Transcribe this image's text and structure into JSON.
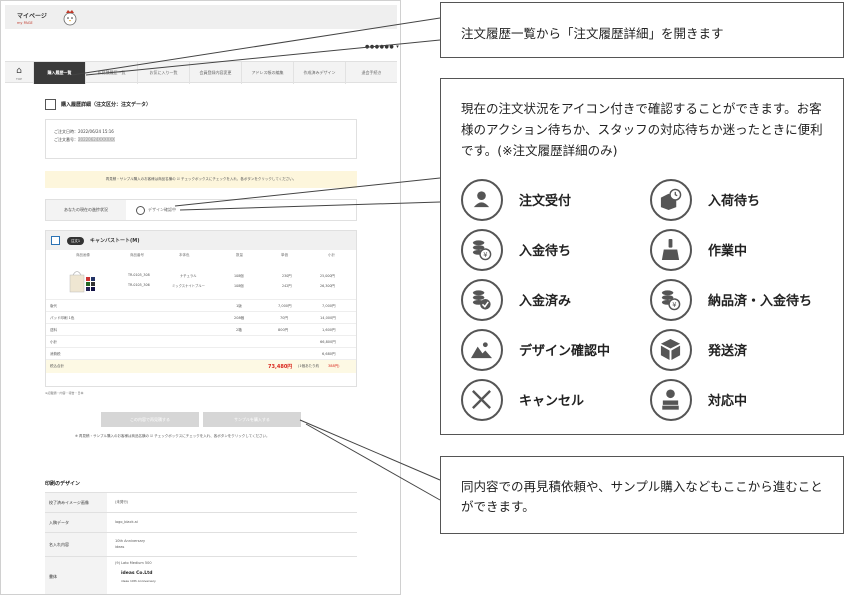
{
  "screenshot": {
    "title": "マイページ",
    "subtitle": "my PAGE",
    "nav": {
      "home_label": "TOP",
      "tabs": [
        "購入履歴一覧",
        "お見積履歴一覧",
        "お気に入り一覧",
        "会員登録内容変更",
        "アドレス帳の編集",
        "作成済みデザイン",
        "退会手続き"
      ],
      "active_index": 0
    },
    "section_title": "購入履歴詳細（注文区分：注文データ）",
    "order_info": {
      "date_label": "ご注文日時：2022/06/24 15:16",
      "number_label": "ご注文番号：",
      "number_value": "20220624XXXXXX"
    },
    "notice": "再見積・サンプル購入のお客様は商品名横の ☑ チェックボックスにチェックを入れ、各ボタンをクリックしてください。",
    "status": {
      "label": "あなたの現在の進捗状況",
      "value": "デザイン確認中"
    },
    "item": {
      "badge": "注文1",
      "name": "キャンバストート(M)",
      "columns": [
        "商品画像",
        "商品番号",
        "本体色",
        "数量",
        "単価",
        "小計"
      ],
      "lines": [
        {
          "code": "TR-0105_308",
          "color": "ナチュラル",
          "qty": "108個",
          "price": "230円",
          "subtotal": "25,000円"
        },
        {
          "code": "TR-0105_306",
          "color": "ミックスナイトブルー",
          "qty": "108個",
          "price": "242円",
          "subtotal": "26,300円"
        }
      ],
      "rows": [
        {
          "label": "版代",
          "qty": "1版",
          "price": "7,000円",
          "subtotal": "7,000円"
        },
        {
          "label": "パッド印刷 1色",
          "qty": "208個",
          "price": "70円",
          "subtotal": "14,000円"
        },
        {
          "label": "送料",
          "qty": "2箱",
          "price": "800円",
          "subtotal": "1,600円"
        },
        {
          "label": "小計",
          "qty": "",
          "price": "",
          "subtotal": "66,800円"
        },
        {
          "label": "消費税",
          "qty": "",
          "price": "",
          "subtotal": "6,680円"
        }
      ],
      "total_label": "税込合計",
      "total_value": "73,480円",
      "per_unit": "(1個あたり約",
      "per_unit_value": "388円)"
    },
    "note_small": "※記載額・内容・報告・日本",
    "buttons": {
      "requote": "この内容で再見積する",
      "sample": "サンプルを購入する"
    },
    "note_bottom": "※ 再見積・サンプル購入のお客様は商品名横の ☑ チェックボックスにチェックを入れ、各ボタンをクリックしてください。",
    "design": {
      "title": "印刷のデザイン",
      "rows": [
        {
          "key": "校了済みイメージ画像",
          "value": "(未発行)"
        },
        {
          "key": "入稿データ",
          "value": "logo_black.ai"
        },
        {
          "key": "名入れ内容",
          "value": "10th Anniversary\nideas"
        },
        {
          "key": "書体",
          "value": "(9) Lato Medium 500"
        }
      ],
      "sample_text_1": "ideas Co.Ltd",
      "sample_text_2": "ideas 10th Anniversary"
    }
  },
  "annotations": {
    "top": "注文履歴一覧から「注文履歴詳細」を開きます",
    "middle": "現在の注文状況をアイコン付きで確認することができます。お客様のアクション待ちか、スタッフの対応待ちか迷ったときに便利です。(※注文履歴詳細のみ)",
    "bottom": "同内容での再見積依頼や、サンプル購入などもここから進むことができます。",
    "statuses": [
      {
        "label": "注文受付",
        "icon": "person-icon"
      },
      {
        "label": "入荷待ち",
        "icon": "box-clock-icon"
      },
      {
        "label": "入金待ち",
        "icon": "coins-wait-icon"
      },
      {
        "label": "作業中",
        "icon": "brush-icon"
      },
      {
        "label": "入金済み",
        "icon": "coins-check-icon"
      },
      {
        "label": "納品済・入金待ち",
        "icon": "coins-yen-icon"
      },
      {
        "label": "デザイン確認中",
        "icon": "image-icon"
      },
      {
        "label": "発送済",
        "icon": "package-icon"
      },
      {
        "label": "キャンセル",
        "icon": "x-icon"
      },
      {
        "label": "対応中",
        "icon": "staff-icon"
      }
    ]
  }
}
